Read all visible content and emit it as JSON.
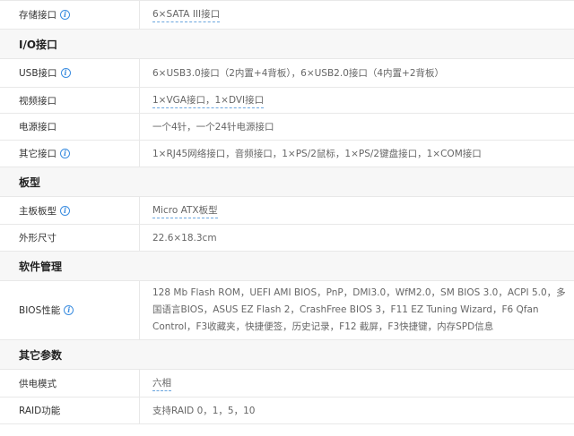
{
  "rows_top": [
    {
      "label": "存储接口",
      "info": true,
      "value": "6×SATA III接口",
      "link": true
    }
  ],
  "sections": [
    {
      "title": "I/O接口",
      "rows": [
        {
          "label": "USB接口",
          "info": true,
          "value": "6×USB3.0接口（2内置+4背板），6×USB2.0接口（4内置+2背板）",
          "link": false
        },
        {
          "label": "视频接口",
          "info": false,
          "value": "1×VGA接口，1×DVI接口",
          "link": true
        },
        {
          "label": "电源接口",
          "info": false,
          "value": "一个4针，一个24针电源接口",
          "link": false
        },
        {
          "label": "其它接口",
          "info": true,
          "value": "1×RJ45网络接口，音频接口，1×PS/2鼠标，1×PS/2键盘接口，1×COM接口",
          "link": false
        }
      ]
    },
    {
      "title": "板型",
      "rows": [
        {
          "label": "主板板型",
          "info": true,
          "value": "Micro ATX板型",
          "link": true
        },
        {
          "label": "外形尺寸",
          "info": false,
          "value": "22.6×18.3cm",
          "link": false
        }
      ]
    },
    {
      "title": "软件管理",
      "rows": [
        {
          "label": "BIOS性能",
          "info": true,
          "value": "128 Mb Flash ROM，UEFI AMI BIOS，PnP，DMI3.0，WfM2.0，SM BIOS 3.0，ACPI 5.0，多国语言BIOS，ASUS EZ Flash 2，CrashFree BIOS 3，F11 EZ Tuning Wizard，F6 Qfan Control，F3收藏夹，快捷便签，历史记录，F12 截屏，F3快捷键，内存SPD信息",
          "link": false,
          "multi": true
        }
      ]
    },
    {
      "title": "其它参数",
      "rows": [
        {
          "label": "供电模式",
          "info": false,
          "value": "六相",
          "link": true
        },
        {
          "label": "RAID功能",
          "info": false,
          "value": "支持RAID 0，1，5，10",
          "link": false
        }
      ]
    }
  ],
  "icons": {
    "info": "info-icon",
    "info_glyph": "i"
  },
  "colors": {
    "border": "#e8e8e8",
    "section_bg": "#f7f7f7",
    "info_blue": "#3b8de0"
  }
}
